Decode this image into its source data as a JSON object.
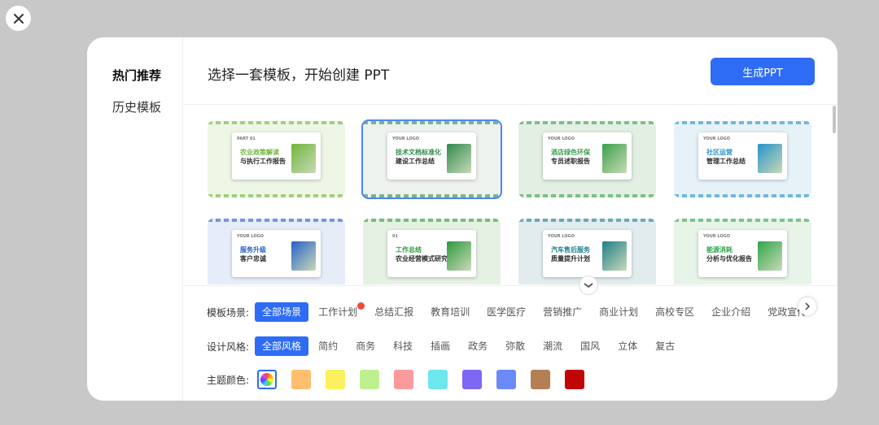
{
  "sidebar": {
    "items": [
      {
        "label": "热门推荐"
      },
      {
        "label": "历史模板"
      }
    ]
  },
  "header": {
    "title": "选择一套模板，开始创建 PPT",
    "generate_label": "生成PPT"
  },
  "templates": [
    {
      "logo": "PART 01",
      "line1": "农业政策解读",
      "line2": "与执行工作报告",
      "accent": "#6fb53a"
    },
    {
      "logo": "YOUR LOGO",
      "line1": "技术文档标准化",
      "line2": "建设工作总结",
      "accent": "#2f8a4e"
    },
    {
      "logo": "YOUR LOGO",
      "line1": "酒店绿色环保",
      "line2": "专员述职报告",
      "accent": "#3aa14a"
    },
    {
      "logo": "YOUR LOGO",
      "line1": "社区运营",
      "line2": "管理工作总结",
      "accent": "#2592c9"
    },
    {
      "logo": "YOUR LOGO",
      "line1": "服务升级",
      "line2": "客户忠诚",
      "accent": "#2560c9"
    },
    {
      "logo": "01",
      "line1": "工作总结",
      "line2": "农业经营模式研究",
      "accent": "#2f9a3e"
    },
    {
      "logo": "YOUR LOGO",
      "line1": "汽车售后服务",
      "line2": "质量提升计划",
      "accent": "#1f7f8a"
    },
    {
      "logo": "YOUR LOGO",
      "line1": "能源消耗",
      "line2": "分析与优化报告",
      "accent": "#2fa64a"
    }
  ],
  "filters": {
    "scene_label": "模板场景:",
    "scenes": [
      {
        "label": "全部场景"
      },
      {
        "label": "工作计划"
      },
      {
        "label": "总结汇报"
      },
      {
        "label": "教育培训"
      },
      {
        "label": "医学医疗"
      },
      {
        "label": "营销推广"
      },
      {
        "label": "商业计划"
      },
      {
        "label": "高校专区"
      },
      {
        "label": "企业介绍"
      },
      {
        "label": "党政宣传"
      }
    ],
    "style_label": "设计风格:",
    "styles": [
      {
        "label": "全部风格"
      },
      {
        "label": "简约"
      },
      {
        "label": "商务"
      },
      {
        "label": "科技"
      },
      {
        "label": "插画"
      },
      {
        "label": "政务"
      },
      {
        "label": "弥散"
      },
      {
        "label": "潮流"
      },
      {
        "label": "国风"
      },
      {
        "label": "立体"
      },
      {
        "label": "复古"
      }
    ],
    "color_label": "主题颜色:",
    "colors": [
      {
        "name": "all-colors",
        "hex": "rainbow"
      },
      {
        "name": "orange",
        "hex": "#fdbf6f"
      },
      {
        "name": "yellow",
        "hex": "#fbf05f"
      },
      {
        "name": "light-green",
        "hex": "#bef08f"
      },
      {
        "name": "pink",
        "hex": "#f99b9c"
      },
      {
        "name": "cyan",
        "hex": "#6ee6ee"
      },
      {
        "name": "purple",
        "hex": "#7f67f5"
      },
      {
        "name": "blue",
        "hex": "#6a8af6"
      },
      {
        "name": "brown",
        "hex": "#b47f53"
      },
      {
        "name": "dark-red",
        "hex": "#c10504"
      }
    ]
  },
  "colors": {
    "primary": "#2e6cf6",
    "hot": "#f04a3c"
  }
}
